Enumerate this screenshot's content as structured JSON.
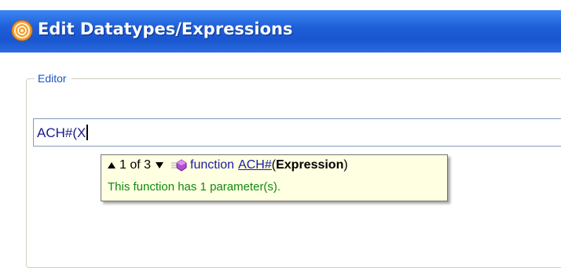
{
  "window": {
    "title": "Edit Datatypes/Expressions",
    "icon": "app-orb-icon"
  },
  "editor_group": {
    "label": "Editor"
  },
  "editor": {
    "value": "ACH#(X"
  },
  "signature_tooltip": {
    "overload_text": "1 of 3",
    "prev_icon": "arrow-up-icon",
    "next_icon": "arrow-down-icon",
    "function_icon": "function-icon",
    "keyword": "function",
    "function_name": "ACH#",
    "open_paren": "(",
    "parameter": "Expression",
    "close_paren": ")",
    "description": "This function has 1 parameter(s)."
  },
  "colors": {
    "title_bar": "#1f5fd8",
    "group_label": "#1b53c9",
    "tooltip_bg": "#ffffe1",
    "description_text": "#118811"
  }
}
